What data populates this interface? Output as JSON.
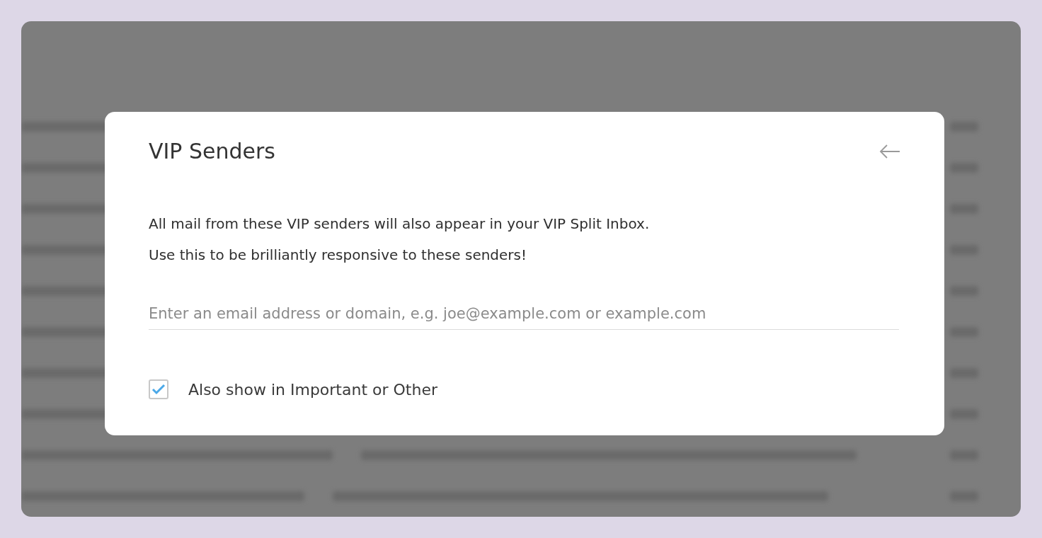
{
  "dialog": {
    "title": "VIP Senders",
    "description": [
      "All mail from these VIP senders will also appear in your VIP Split Inbox.",
      "Use this to be brilliantly responsive to these senders!"
    ],
    "input": {
      "placeholder": "Enter an email address or domain, e.g. joe@example.com or example.com"
    },
    "option": {
      "label": "Also show in Important or Other",
      "checked": true
    }
  }
}
